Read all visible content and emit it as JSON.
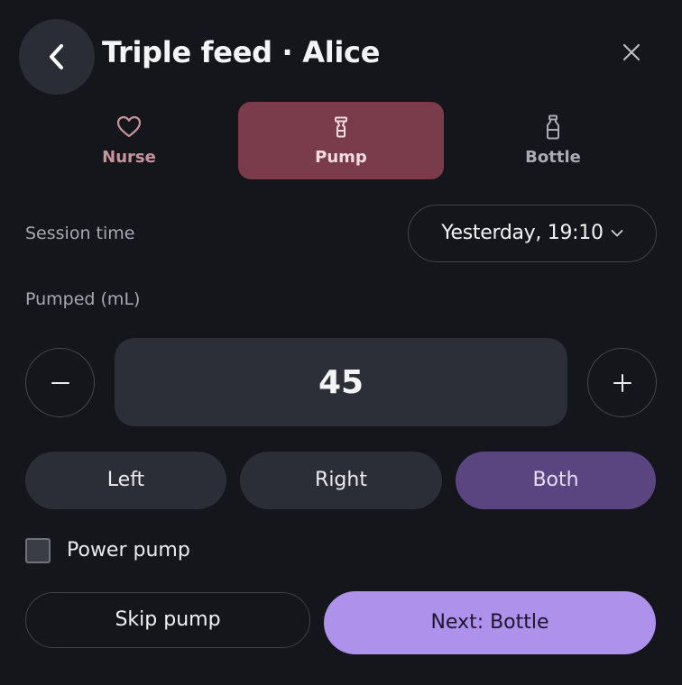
{
  "header": {
    "title": "Triple feed · Alice",
    "back_icon": "chevron-left-icon",
    "close_icon": "close-icon"
  },
  "tabs": [
    {
      "label": "Nurse",
      "icon": "heart-icon",
      "selected": false
    },
    {
      "label": "Pump",
      "icon": "pump-icon",
      "selected": true
    },
    {
      "label": "Bottle",
      "icon": "bottle-icon",
      "selected": false
    }
  ],
  "session": {
    "label": "Session time",
    "value": "Yesterday, 19:10"
  },
  "pumped": {
    "label": "Pumped (mL)",
    "amount": "45",
    "minus": "−",
    "plus": "+"
  },
  "sides": {
    "options": [
      "Left",
      "Right",
      "Both"
    ],
    "selected": "Both"
  },
  "power_pump": {
    "label": "Power pump",
    "checked": false
  },
  "actions": {
    "skip_label": "Skip pump",
    "next_label": "Next: Bottle"
  },
  "colors": {
    "background": "#15161b",
    "pump_tab": "#7a3c4b",
    "side_selected": "#5b4580",
    "primary_button": "#ae91ea"
  }
}
